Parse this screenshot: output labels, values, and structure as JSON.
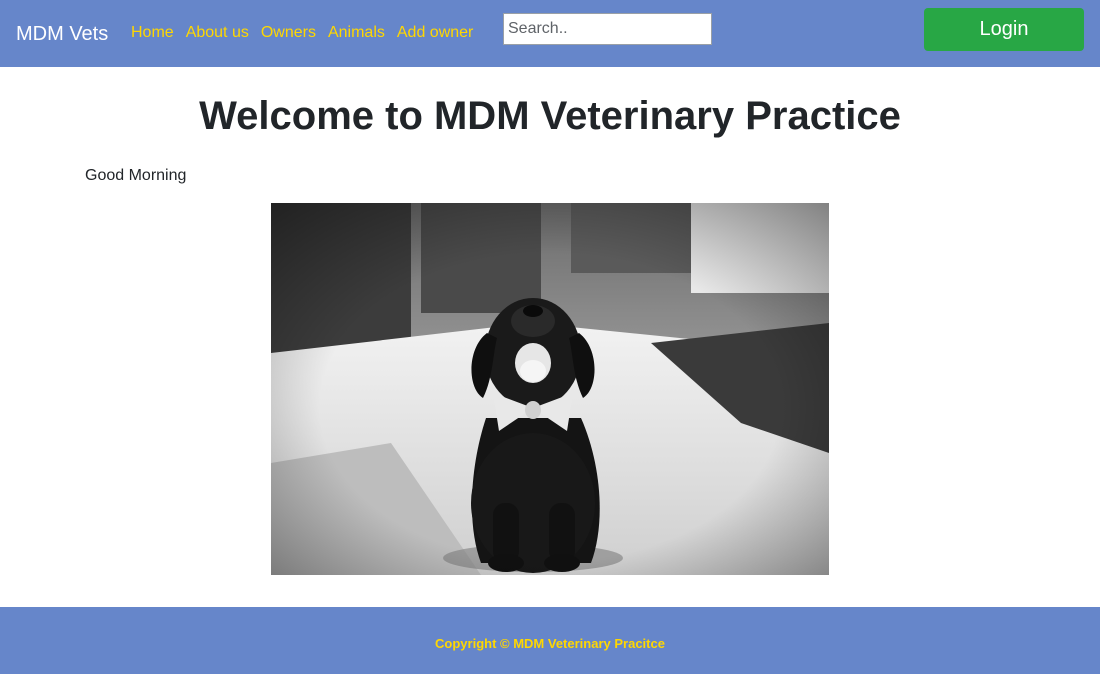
{
  "navbar": {
    "brand": "MDM Vets",
    "links": [
      {
        "label": "Home"
      },
      {
        "label": "About us"
      },
      {
        "label": "Owners"
      },
      {
        "label": "Animals"
      },
      {
        "label": "Add owner"
      }
    ],
    "search": {
      "placeholder": "Search..",
      "value": ""
    },
    "login_label": "Login"
  },
  "main": {
    "title": "Welcome to MDM Veterinary Practice",
    "greeting": "Good Morning",
    "image": {
      "subject": "black puppy wearing a white bow tie, black-and-white photo"
    }
  },
  "footer": {
    "copyright": "Copyright © MDM Veterinary Pracitce"
  },
  "colors": {
    "navbar_bg": "#6686ca",
    "link": "#ffd700",
    "login_bg": "#28a745",
    "footer_bg": "#6686ca",
    "footer_text": "#ffd700"
  }
}
